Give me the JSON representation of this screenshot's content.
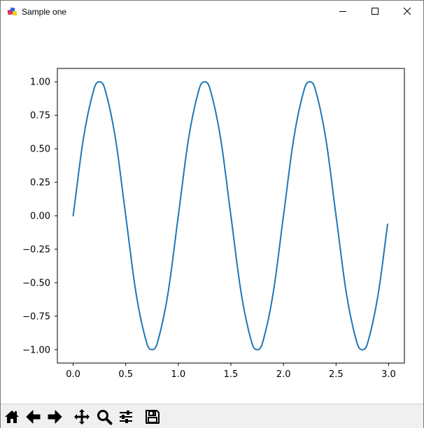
{
  "window": {
    "title": "Sample one",
    "buttons": [
      "minimize-icon",
      "maximize-icon",
      "close-icon"
    ]
  },
  "toolbar": {
    "tools": [
      "home-icon",
      "back-arrow-icon",
      "forward-arrow-icon",
      "pan-icon",
      "zoom-icon",
      "configure-subplots-icon",
      "save-icon"
    ]
  },
  "chart_data": {
    "type": "line",
    "title": "",
    "xlabel": "",
    "ylabel": "",
    "xlim": [
      -0.15,
      3.15
    ],
    "ylim": [
      -1.1,
      1.1
    ],
    "x_ticks": [
      "0.0",
      "0.5",
      "1.0",
      "1.5",
      "2.0",
      "2.5",
      "3.0"
    ],
    "x_tick_values": [
      0.0,
      0.5,
      1.0,
      1.5,
      2.0,
      2.5,
      3.0
    ],
    "y_ticks": [
      "1.00",
      "0.75",
      "0.50",
      "0.25",
      "0.00",
      "−0.25",
      "−0.50",
      "−0.75",
      "−1.00"
    ],
    "y_tick_values": [
      1.0,
      0.75,
      0.5,
      0.25,
      0.0,
      -0.25,
      -0.5,
      -0.75,
      -1.0
    ],
    "grid": false,
    "line_color": "#1f77b4",
    "series": [
      {
        "x": [
          0.0,
          0.1,
          0.2,
          0.25,
          0.3,
          0.4,
          0.5,
          0.6,
          0.7,
          0.75,
          0.8,
          0.9,
          1.0,
          1.1,
          1.2,
          1.25,
          1.3,
          1.4,
          1.5,
          1.6,
          1.7,
          1.75,
          1.8,
          1.9,
          2.0,
          2.1,
          2.2,
          2.25,
          2.3,
          2.4,
          2.5,
          2.6,
          2.7,
          2.75,
          2.8,
          2.9,
          2.99
        ],
        "y": [
          0.0,
          0.588,
          0.951,
          1.0,
          0.951,
          0.588,
          0.0,
          -0.588,
          -0.951,
          -1.0,
          -0.951,
          -0.588,
          0.0,
          0.588,
          0.951,
          1.0,
          0.951,
          0.588,
          0.0,
          -0.588,
          -0.951,
          -1.0,
          -0.951,
          -0.588,
          0.0,
          0.588,
          0.951,
          1.0,
          0.951,
          0.588,
          0.0,
          -0.588,
          -0.951,
          -1.0,
          -0.951,
          -0.588,
          -0.063
        ]
      }
    ]
  }
}
